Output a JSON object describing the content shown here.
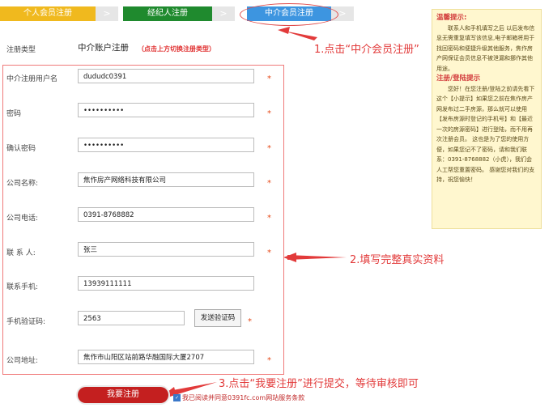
{
  "tabs": {
    "personal": "个人会员注册",
    "agent": "经纪人注册",
    "agency": "中介会员注册",
    "chevron": ">"
  },
  "form": {
    "type_label": "注册类型",
    "type_value": "中介账户注册",
    "type_hint": "（点击上方切换注册类型）",
    "required_mark": "*",
    "fields": [
      {
        "label": "中介注册用户名",
        "value": "dududc0391"
      },
      {
        "label": "密码",
        "value": "••••••••••"
      },
      {
        "label": "确认密码",
        "value": "••••••••••"
      },
      {
        "label": "公司名称:",
        "value": "焦作房产网络科技有限公司"
      },
      {
        "label": "公司电话:",
        "value": "0391-8768882"
      },
      {
        "label": "联 系 人:",
        "value": "张三"
      },
      {
        "label": "联系手机:",
        "value": "13939111111"
      },
      {
        "label": "手机验证码:",
        "value": "2563"
      },
      {
        "label": "公司地址:",
        "value": "焦作市山阳区站前路华融国际大厦2707"
      }
    ],
    "send_code_label": "发送验证码",
    "submit_label": "我要注册",
    "agree_text": "我已阅读并同意0391fc.com网站服务条款"
  },
  "tip": {
    "title1": "温馨提示:",
    "body1": "联系人和手机填写之后 以后发布信息无需重复填写该信息,电子邮箱将用于找回密码和便捷升级其他服务，焦作房产网保证会员信息不被泄漏和挪作其他用途。",
    "title2": "注册/登陆提示",
    "body2": "您好！在您注册/登陆之前请先看下这个【小提示】如果您之前在焦作房产网发布过二手房源，那么就可以使用【发布房源时登记的手机号】和【最近一次的房源密码】进行登陆，而不用再次注册会员。 这也是为了您的使用方便，如果您记不了密码，请和我们联系：0391-8768882（小虎），我们会人工帮您重置密码。 感谢您对我们的支持，祝您愉快！"
  },
  "annotations": {
    "a1": "1.点击“中介会员注册”",
    "a2": "2.填写完整真实资料",
    "a3": "3.点击“我要注册”进行提交，等待审核即可"
  },
  "colors": {
    "accent_red": "#e23a3a",
    "tab_yellow": "#f0b91e",
    "tab_green": "#1f8a2e",
    "tab_blue": "#3d95e0"
  }
}
